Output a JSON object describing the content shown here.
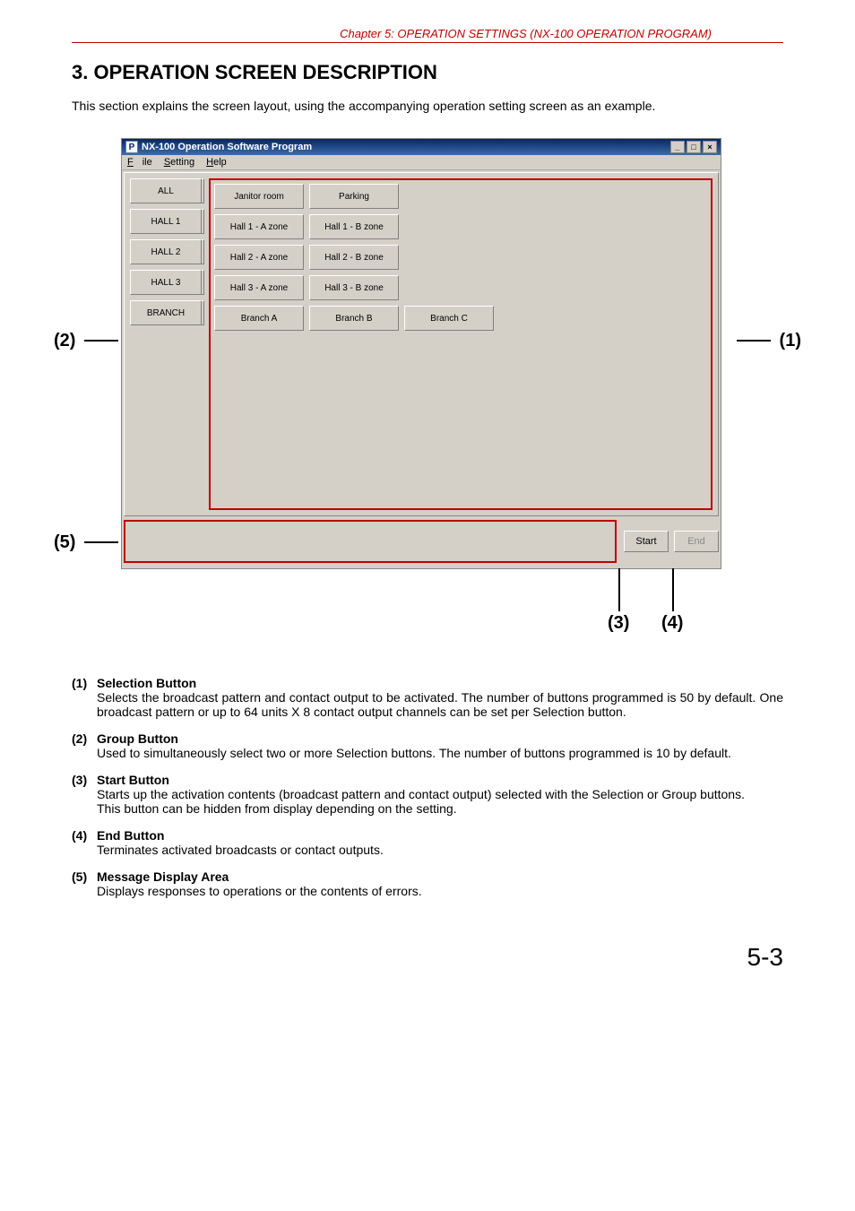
{
  "header": "Chapter 5:  OPERATION SETTINGS (NX-100 OPERATION PROGRAM)",
  "section_title": "3. OPERATION SCREEN DESCRIPTION",
  "intro": "This section explains the screen layout, using the accompanying operation setting screen as an example.",
  "window": {
    "title": "NX-100 Operation Software Program",
    "menu": {
      "file": "File",
      "setting": "Setting",
      "help": "Help"
    },
    "group_buttons": [
      "ALL",
      "HALL 1",
      "HALL 2",
      "HALL 3",
      "BRANCH"
    ],
    "selection_buttons": [
      [
        "Janitor room",
        "Parking",
        "",
        "",
        ""
      ],
      [
        "Hall 1 - A zone",
        "Hall 1 - B zone",
        "",
        "",
        ""
      ],
      [
        "Hall 2 - A zone",
        "Hall 2 - B zone",
        "",
        "",
        ""
      ],
      [
        "Hall 3 - A zone",
        "Hall 3 - B zone",
        "",
        "",
        ""
      ],
      [
        "Branch A",
        "Branch B",
        "Branch C",
        "",
        ""
      ]
    ],
    "start": "Start",
    "end": "End"
  },
  "callouts": {
    "c1": "(1)",
    "c2": "(2)",
    "c3": "(3)",
    "c4": "(4)",
    "c5": "(5)"
  },
  "desc": [
    {
      "num": "(1)",
      "title": "Selection Button",
      "body": "Selects the broadcast pattern and contact output to be activated. The number of buttons programmed is 50 by default. One broadcast pattern or up to 64 units X 8 contact output channels can be set per Selection button."
    },
    {
      "num": "(2)",
      "title": "Group Button",
      "body": "Used to simultaneously select two or more Selection buttons. The number of buttons programmed is 10 by default."
    },
    {
      "num": "(3)",
      "title": "Start Button",
      "body": "Starts up the activation contents (broadcast pattern and contact output) selected with the Selection or Group buttons.\nThis button can be hidden from display depending on the setting."
    },
    {
      "num": "(4)",
      "title": "End Button",
      "body": "Terminates activated broadcasts or contact outputs."
    },
    {
      "num": "(5)",
      "title": "Message Display Area",
      "body": "Displays responses to operations or the contents of errors."
    }
  ],
  "page_number": "5-3"
}
